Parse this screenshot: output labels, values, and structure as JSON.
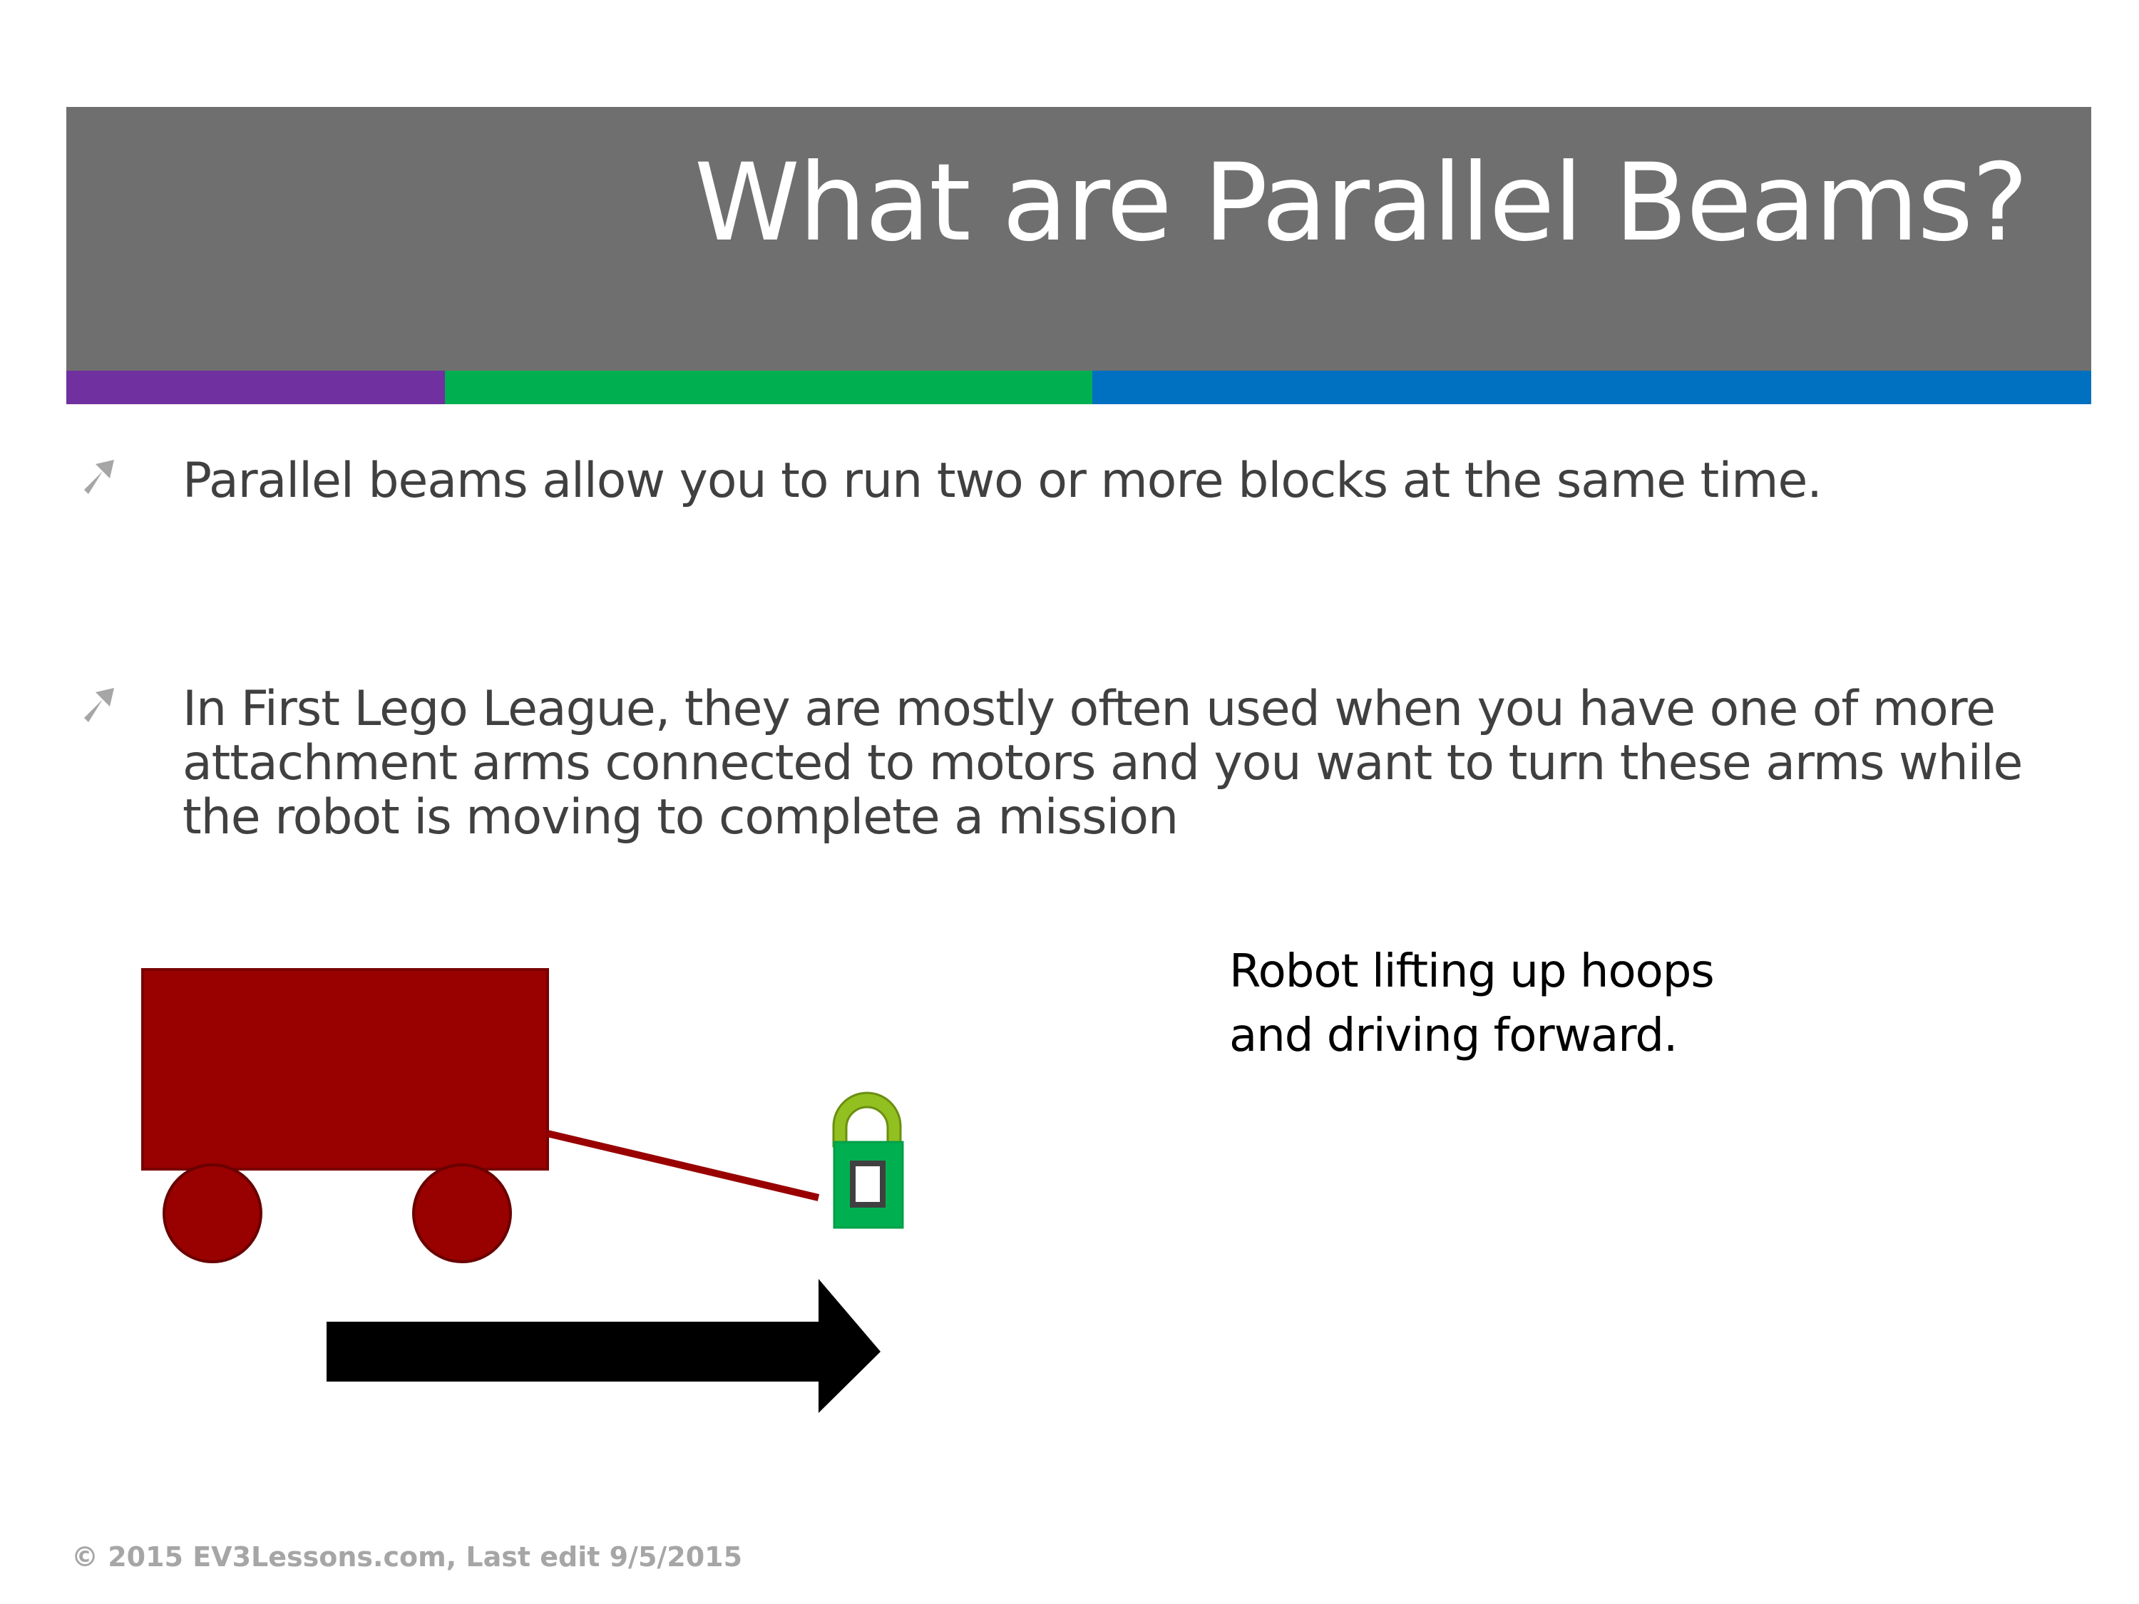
{
  "slide": {
    "title": "What are Parallel Beams?",
    "accent_colors": {
      "purple": "#7030a0",
      "green": "#00b050",
      "blue": "#0070c0"
    },
    "title_bar_color": "#6f6f6f"
  },
  "bullets": [
    {
      "icon": "arrow-up-right-icon",
      "text": "Parallel beams allow you to run two or more blocks at the same time."
    },
    {
      "icon": "arrow-up-right-icon",
      "text": "In First Lego League, they are mostly often used when you have one of more attachment arms connected to motors and you want to turn these arms while the robot is moving to complete a mission"
    }
  ],
  "illustration": {
    "robot_color": "#990000",
    "hoop_color": "#00b050",
    "hoop_handle_color": "#92c020",
    "arrow_color": "#000000"
  },
  "caption": "Robot lifting up hoops and driving forward.",
  "footer": "© 2015 EV3Lessons.com, Last edit 9/5/2015"
}
